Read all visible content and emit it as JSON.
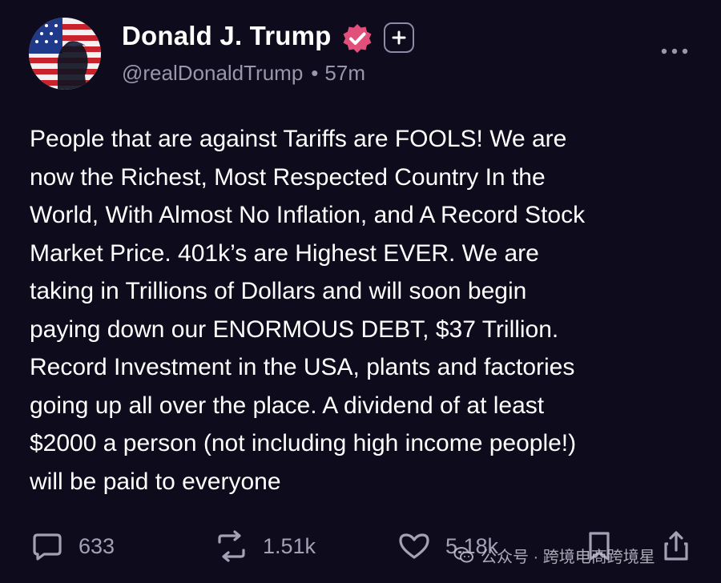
{
  "header": {
    "display_name": "Donald J. Trump",
    "handle": "@realDonaldTrump",
    "separator": "•",
    "timestamp": "57m",
    "verified_badge_color": "#e0507a",
    "plus_button_icon": "plus-icon",
    "more_icon": "more-horizontal-icon"
  },
  "post": {
    "lines": [
      "People that are against Tariffs are FOOLS! We are",
      "now the Richest, Most Respected Country In the",
      "World, With Almost No Inflation, and A Record Stock",
      "Market Price. 401k’s are Highest EVER. We are",
      "taking in Trillions of Dollars and will soon begin",
      "paying down our ENORMOUS DEBT, $37 Trillion.",
      "Record Investment in the USA, plants and factories",
      "going up all over the place. A dividend of at least",
      "$2000 a person (not including high income people!)",
      "will be paid to everyone"
    ]
  },
  "actions": {
    "reply": {
      "icon": "reply-icon",
      "count": "633"
    },
    "repost": {
      "icon": "repost-icon",
      "count": "1.51k"
    },
    "like": {
      "icon": "heart-icon",
      "count": "5.18k"
    },
    "bookmark": {
      "icon": "bookmark-icon"
    },
    "share": {
      "icon": "share-icon"
    }
  },
  "watermark": {
    "text": "公众号 · 跨境电商跨境星",
    "icon": "wechat-icon"
  },
  "colors": {
    "background": "#0d0b1c",
    "text_primary": "#ffffff",
    "text_secondary": "#9a96ab"
  }
}
